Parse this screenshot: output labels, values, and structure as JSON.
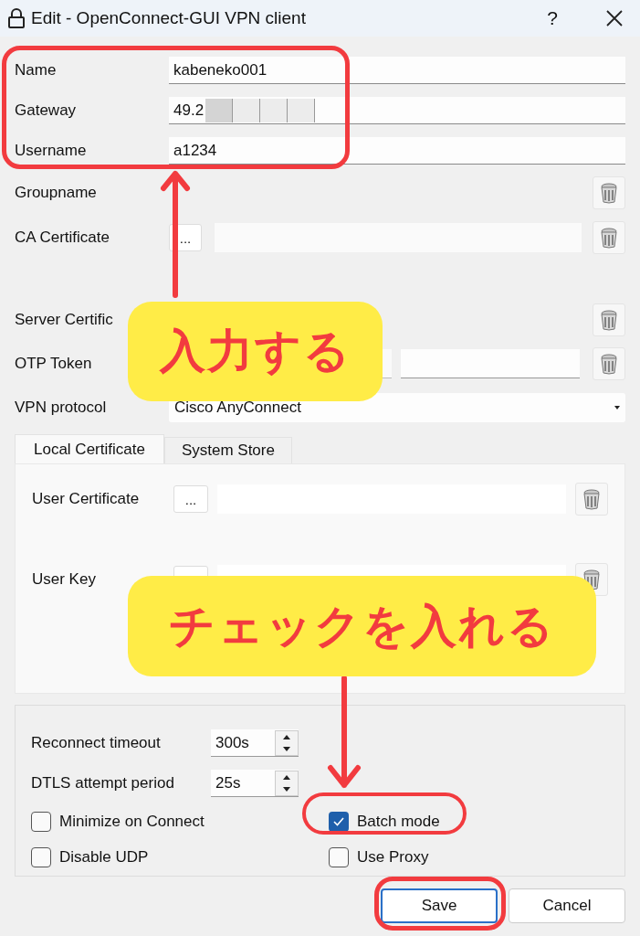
{
  "window": {
    "title": "Edit - OpenConnect-GUI VPN client",
    "help": "?"
  },
  "fields": [
    {
      "kind": "text",
      "label": "Name",
      "value": "kabeneko001"
    },
    {
      "kind": "text",
      "label": "Gateway",
      "value": "49.2",
      "redacted": true
    },
    {
      "kind": "text",
      "label": "Username",
      "value": "a1234"
    },
    {
      "kind": "clear",
      "label": "Groupname"
    },
    {
      "kind": "file",
      "label": "CA Certificate",
      "browse": "..."
    },
    {
      "kind": "clear",
      "label": "Server Certific"
    },
    {
      "kind": "otp",
      "label": "OTP Token"
    },
    {
      "kind": "select",
      "label": "VPN protocol",
      "value": "Cisco AnyConnect"
    }
  ],
  "tabs": [
    {
      "label": "Local Certificate",
      "selected": true
    },
    {
      "label": "System Store",
      "selected": false
    }
  ],
  "tab_panel": [
    {
      "label": "User Certificate",
      "browse": "..."
    },
    {
      "label": "User Key"
    }
  ],
  "spinners": [
    {
      "label": "Reconnect timeout",
      "value": "300s"
    },
    {
      "label": "DTLS attempt period",
      "value": "25s"
    }
  ],
  "checkboxes": [
    {
      "label": "Minimize on Connect",
      "checked": false
    },
    {
      "label": "Batch mode",
      "checked": true
    },
    {
      "label": "Disable UDP",
      "checked": false
    },
    {
      "label": "Use Proxy",
      "checked": false
    }
  ],
  "buttons": [
    {
      "label": "Save",
      "default": true
    },
    {
      "label": "Cancel",
      "default": false
    }
  ],
  "callouts": [
    {
      "text": "入力する"
    },
    {
      "text": "チェックを入れる"
    }
  ]
}
